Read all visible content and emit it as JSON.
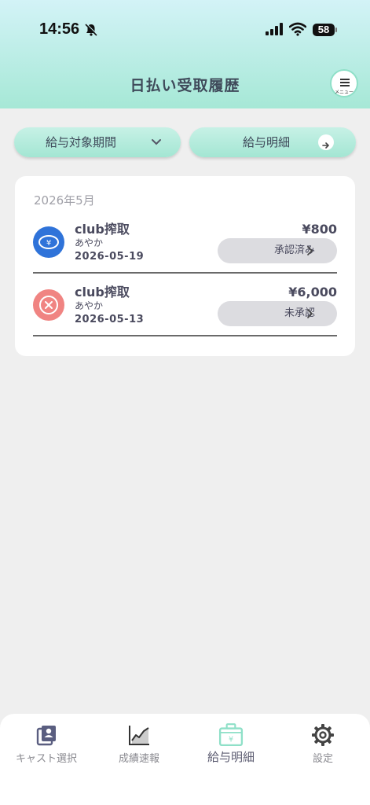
{
  "status_bar": {
    "time": "14:56",
    "battery": "58"
  },
  "header": {
    "title": "日払い受取履歴",
    "menu_label": "メニュー"
  },
  "filters": {
    "period_label": "給与対象期間",
    "slip_label": "給与明細"
  },
  "history": {
    "month": "2026年5月",
    "rows": [
      {
        "shop": "club搾取",
        "cast": "あやか",
        "date": "2026-05-19",
        "amount": "¥800",
        "status": "承認済み",
        "status_icon": "yen-coin-icon"
      },
      {
        "shop": "club搾取",
        "cast": "あやか",
        "date": "2026-05-13",
        "amount": "¥6,000",
        "status": "未承認",
        "status_icon": "x-circle-icon"
      }
    ]
  },
  "tabbar": {
    "items": [
      {
        "label": "キャスト選択",
        "icon": "cast-select-icon"
      },
      {
        "label": "成績速報",
        "icon": "chart-icon"
      },
      {
        "label": "給与明細",
        "icon": "salary-bag-icon",
        "active": true
      },
      {
        "label": "設定",
        "icon": "gear-icon"
      }
    ]
  },
  "colors": {
    "accent": "#a6e8d6",
    "approved_icon": "#2f73d9",
    "unapproved_icon": "#f08482"
  }
}
